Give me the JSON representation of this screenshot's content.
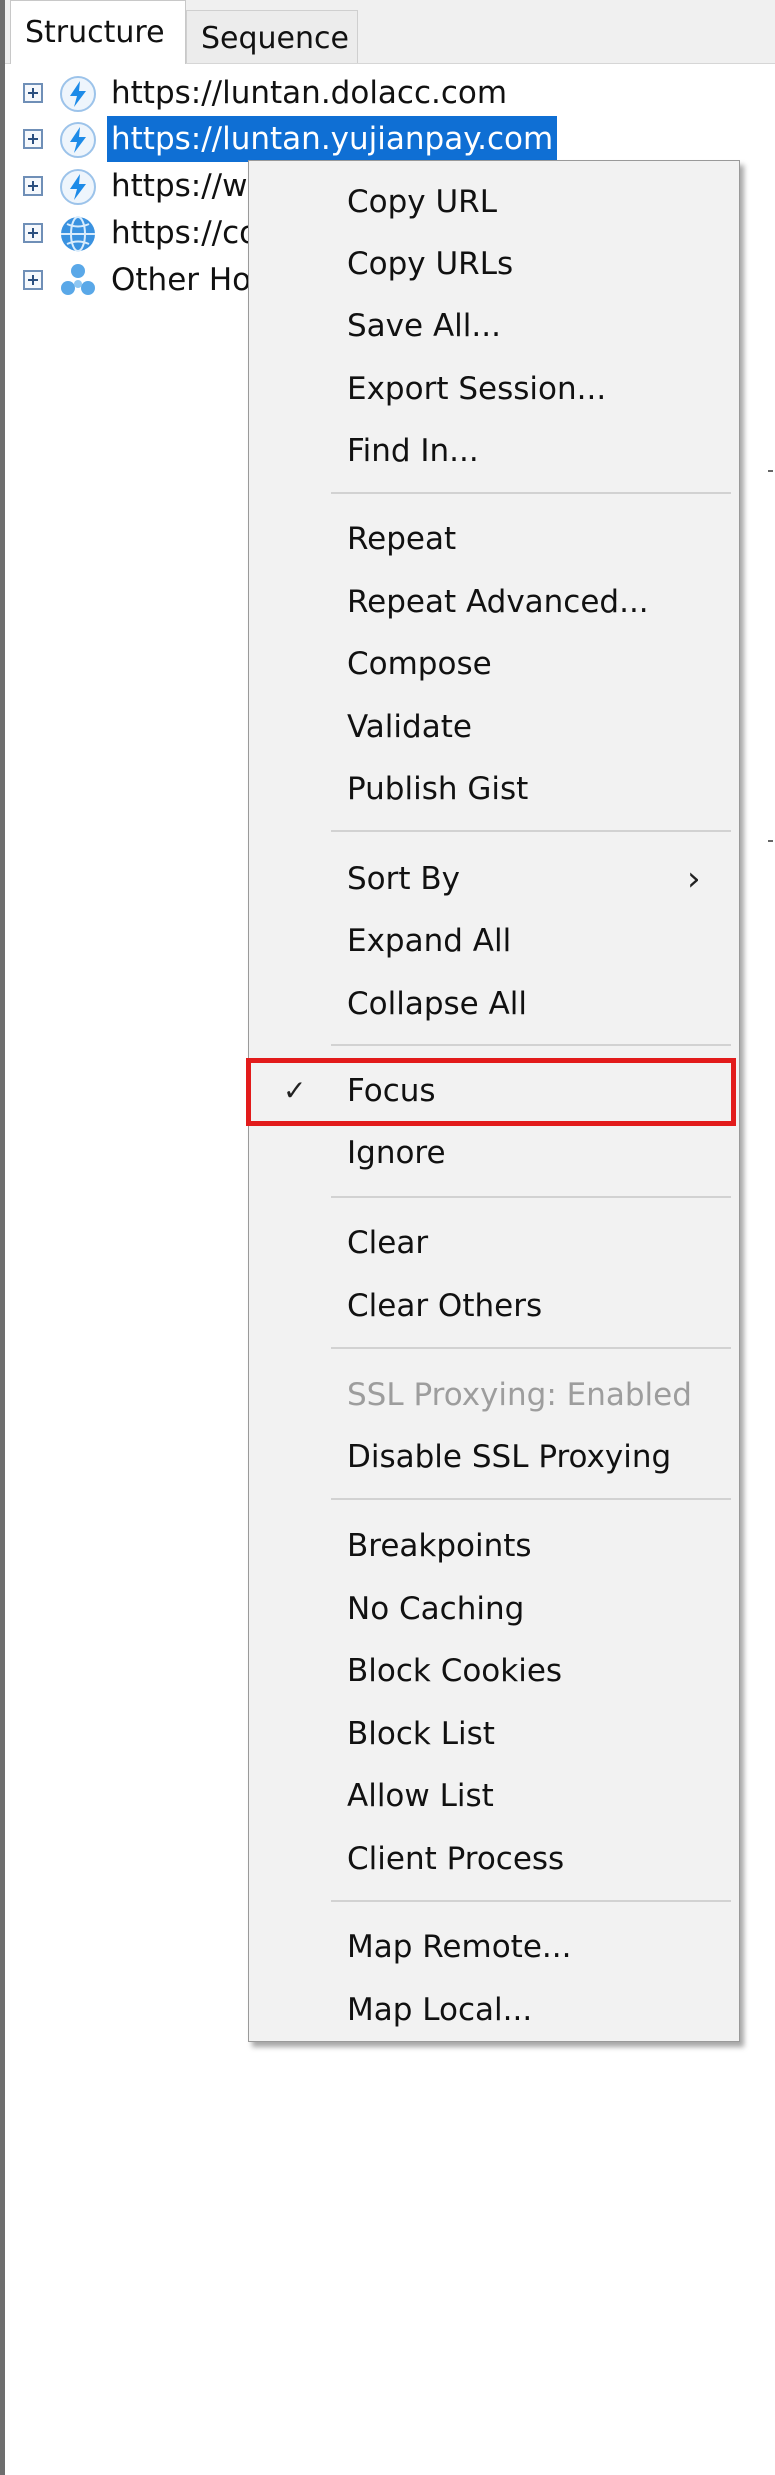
{
  "tabs": [
    "Structure",
    "Sequence"
  ],
  "tree": {
    "hosts": [
      {
        "label": "https://luntan.dolacc.com",
        "icon": "lightning-icon"
      },
      {
        "label": "https://luntan.yujianpay.com",
        "icon": "lightning-icon",
        "selected": true
      },
      {
        "label": "https://w",
        "icon": "lightning-icon"
      },
      {
        "label": "https://co",
        "icon": "globe-icon"
      },
      {
        "label": "Other Ho",
        "icon": "other-hosts-icon"
      }
    ]
  },
  "menu": {
    "items": [
      "Copy URL",
      "Copy URLs",
      "Save All...",
      "Export Session...",
      "Find In...",
      "Repeat",
      "Repeat Advanced...",
      "Compose",
      "Validate",
      "Publish Gist",
      "Sort By",
      "Expand All",
      "Collapse All",
      "Focus",
      "Ignore",
      "Clear",
      "Clear Others",
      "SSL Proxying: Enabled",
      "Disable SSL Proxying",
      "Breakpoints",
      "No Caching",
      "Block Cookies",
      "Block List",
      "Allow List",
      "Client Process",
      "Map Remote...",
      "Map Local..."
    ],
    "checked_item": "Focus",
    "disabled_item": "SSL Proxying: Enabled",
    "submenu_item": "Sort By"
  },
  "colors": {
    "selection": "#0f6fd4",
    "highlight_box": "#e21b1b"
  }
}
